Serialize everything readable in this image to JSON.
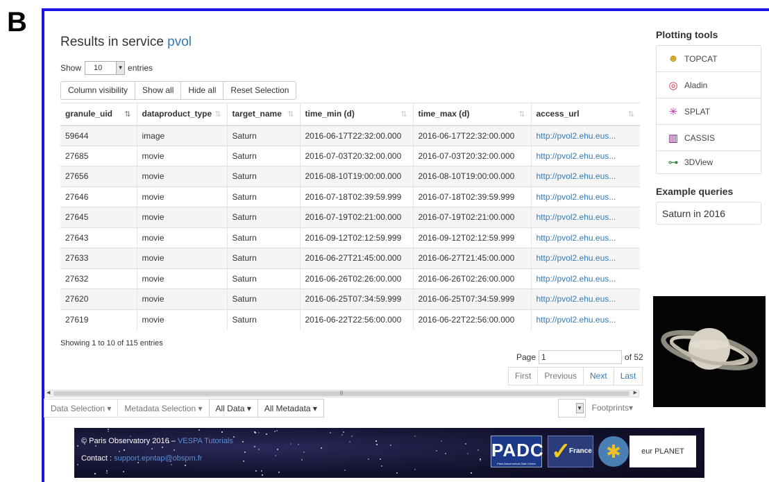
{
  "panel_letter": "B",
  "page_title": {
    "prefix": "Results in service",
    "service": "pvol"
  },
  "length_menu": {
    "show": "Show",
    "value": "10",
    "entries": "entries"
  },
  "buttons": [
    "Column visibility",
    "Show all",
    "Hide all",
    "Reset Selection"
  ],
  "table": {
    "columns": [
      "granule_uid",
      "dataproduct_type",
      "target_name",
      "time_min (d)",
      "time_max (d)",
      "access_url"
    ],
    "rows": [
      [
        "59644",
        "image",
        "Saturn",
        "2016-06-17T22:32:00.000",
        "2016-06-17T22:32:00.000",
        "http://pvol2.ehu.eus..."
      ],
      [
        "27685",
        "movie",
        "Saturn",
        "2016-07-03T20:32:00.000",
        "2016-07-03T20:32:00.000",
        "http://pvol2.ehu.eus..."
      ],
      [
        "27656",
        "movie",
        "Saturn",
        "2016-08-10T19:00:00.000",
        "2016-08-10T19:00:00.000",
        "http://pvol2.ehu.eus..."
      ],
      [
        "27646",
        "movie",
        "Saturn",
        "2016-07-18T02:39:59.999",
        "2016-07-18T02:39:59.999",
        "http://pvol2.ehu.eus..."
      ],
      [
        "27645",
        "movie",
        "Saturn",
        "2016-07-19T02:21:00.000",
        "2016-07-19T02:21:00.000",
        "http://pvol2.ehu.eus..."
      ],
      [
        "27643",
        "movie",
        "Saturn",
        "2016-09-12T02:12:59.999",
        "2016-09-12T02:12:59.999",
        "http://pvol2.ehu.eus..."
      ],
      [
        "27633",
        "movie",
        "Saturn",
        "2016-06-27T21:45:00.000",
        "2016-06-27T21:45:00.000",
        "http://pvol2.ehu.eus..."
      ],
      [
        "27632",
        "movie",
        "Saturn",
        "2016-06-26T02:26:00.000",
        "2016-06-26T02:26:00.000",
        "http://pvol2.ehu.eus..."
      ],
      [
        "27620",
        "movie",
        "Saturn",
        "2016-06-25T07:34:59.999",
        "2016-06-25T07:34:59.999",
        "http://pvol2.ehu.eus..."
      ],
      [
        "27619",
        "movie",
        "Saturn",
        "2016-06-22T22:56:00.000",
        "2016-06-22T22:56:00.000",
        "http://pvol2.ehu.eus..."
      ]
    ]
  },
  "info": "Showing 1 to 10 of 115 entries",
  "pagination": {
    "page_label": "Page",
    "page_value": "1",
    "of_label": "of 52",
    "buttons": [
      "First",
      "Previous",
      "Next",
      "Last"
    ]
  },
  "bottom_bar": {
    "data_selection": "Data Selection ▾",
    "metadata_selection": "Metadata Selection ▾",
    "all_data": "All Data ▾",
    "all_metadata": "All Metadata ▾",
    "footprints": "Footprints▾"
  },
  "footer": {
    "copyright": "© Paris Observatory 2016 – ",
    "tutorials": "VESPA Tutorials",
    "contact_label": "Contact : ",
    "contact_email": "support.epntap@obspm.fr",
    "padc": "PADC",
    "vo_france": "France",
    "europlanet": "eur PLANET"
  },
  "sidebar": {
    "plotting_title": "Plotting tools",
    "tools": [
      {
        "label": "TOPCAT",
        "icon": "topcat-icon"
      },
      {
        "label": "Aladin",
        "icon": "aladin-icon"
      },
      {
        "label": "SPLAT",
        "icon": "splat-icon"
      },
      {
        "label": "CASSIS",
        "icon": "cassis-icon"
      },
      {
        "label": "3DView",
        "icon": "3dview-icon"
      }
    ],
    "examples_title": "Example queries",
    "example_query": "Saturn in 2016"
  },
  "colors": {
    "frame": "#1a14e6",
    "link": "#337ab7"
  }
}
